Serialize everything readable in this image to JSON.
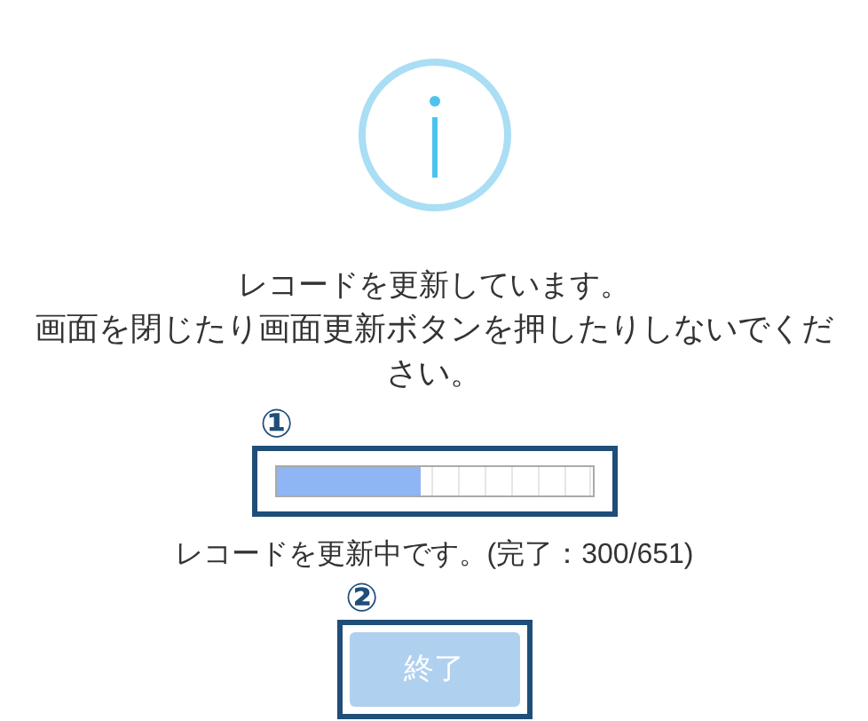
{
  "message": {
    "line1": "レコードを更新しています。",
    "line2": "画面を閉じたり画面更新ボタンを押したりしないでください。"
  },
  "annotations": [
    {
      "label": "①"
    },
    {
      "label": "②"
    }
  ],
  "progress": {
    "level": 0.46
  },
  "status": "レコードを更新中です。(完了：300/651)",
  "button": {
    "label": "終了",
    "disabled": true
  }
}
